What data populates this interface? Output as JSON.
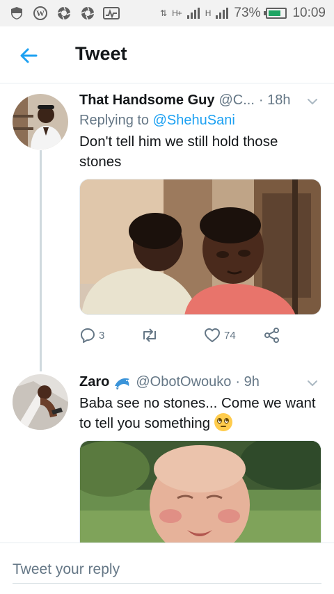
{
  "status_bar": {
    "signal_1": "H+",
    "signal_2": "H",
    "battery": "73%",
    "battery_level": 0.73,
    "time": "10:09"
  },
  "header": {
    "title": "Tweet",
    "back_icon": "arrow-left-icon"
  },
  "tweets": [
    {
      "name": "That Handsome Guy",
      "handle": "@C...",
      "time": "· 18h",
      "replying_prefix": "Replying to ",
      "replying_to": "@ShehuSani",
      "text": "Don't tell him we still hold those stones",
      "replies": "3",
      "retweets": "",
      "likes": "74"
    },
    {
      "name": "Zaro",
      "handle": "@ObotOwouko",
      "time": "· 9h",
      "text": "Baba see no stones... Come we want to tell you something",
      "name_emoji": "dolphin-icon",
      "text_emoji": "face-with-rolling-eyes-icon"
    }
  ],
  "reply_bar": {
    "placeholder": "Tweet your reply"
  },
  "colors": {
    "accent": "#1da1f2",
    "muted": "#657786",
    "divider": "#e6ecf0"
  }
}
